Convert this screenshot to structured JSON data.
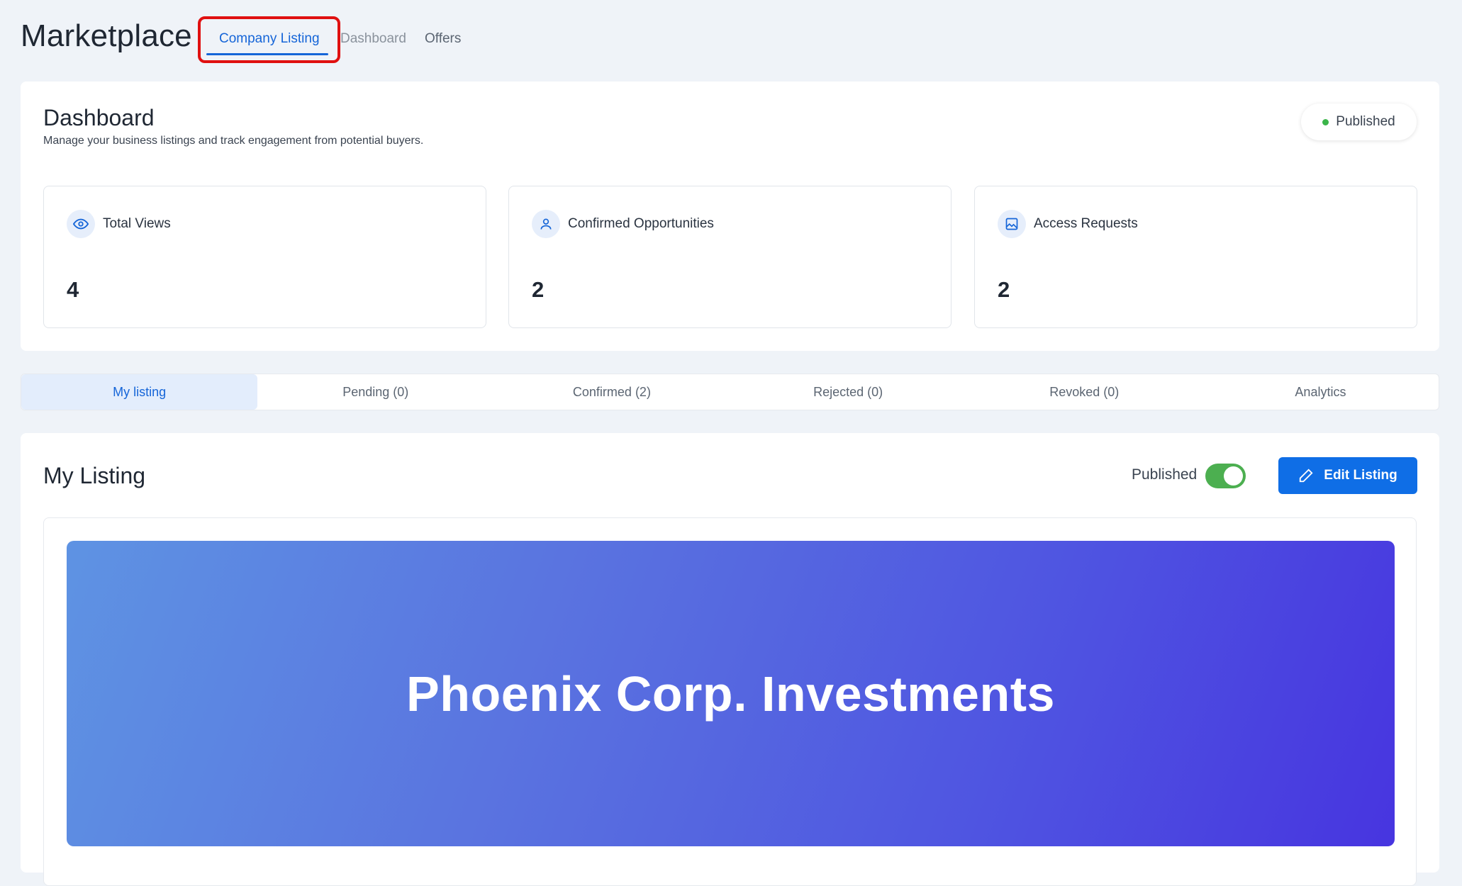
{
  "header": {
    "app_title": "Marketplace",
    "nav_tabs": [
      {
        "label": "Company Listing",
        "active": true
      },
      {
        "label": "Dashboard",
        "active": false
      },
      {
        "label": "Offers",
        "active": false
      }
    ]
  },
  "dashboard": {
    "title": "Dashboard",
    "subtitle": "Manage your business listings and track engagement from potential buyers.",
    "status_label": "Published",
    "status_color": "#3bb54a",
    "stats": [
      {
        "icon": "eye-icon",
        "label": "Total Views",
        "value": "4"
      },
      {
        "icon": "user-icon",
        "label": "Confirmed Opportunities",
        "value": "2"
      },
      {
        "icon": "image-icon",
        "label": "Access Requests",
        "value": "2"
      }
    ]
  },
  "listing_tabs": [
    {
      "label": "My listing",
      "active": true
    },
    {
      "label": "Pending (0)",
      "active": false
    },
    {
      "label": "Confirmed (2)",
      "active": false
    },
    {
      "label": "Rejected (0)",
      "active": false
    },
    {
      "label": "Revoked (0)",
      "active": false
    },
    {
      "label": "Analytics",
      "active": false
    }
  ],
  "my_listing": {
    "title": "My Listing",
    "published_label": "Published",
    "published": true,
    "edit_button_label": "Edit Listing",
    "banner_title": "Phoenix Corp. Investments"
  },
  "colors": {
    "accent": "#1565d8",
    "button": "#0f6ee6",
    "toggle_on": "#4caf50",
    "highlight": "#e01010"
  }
}
